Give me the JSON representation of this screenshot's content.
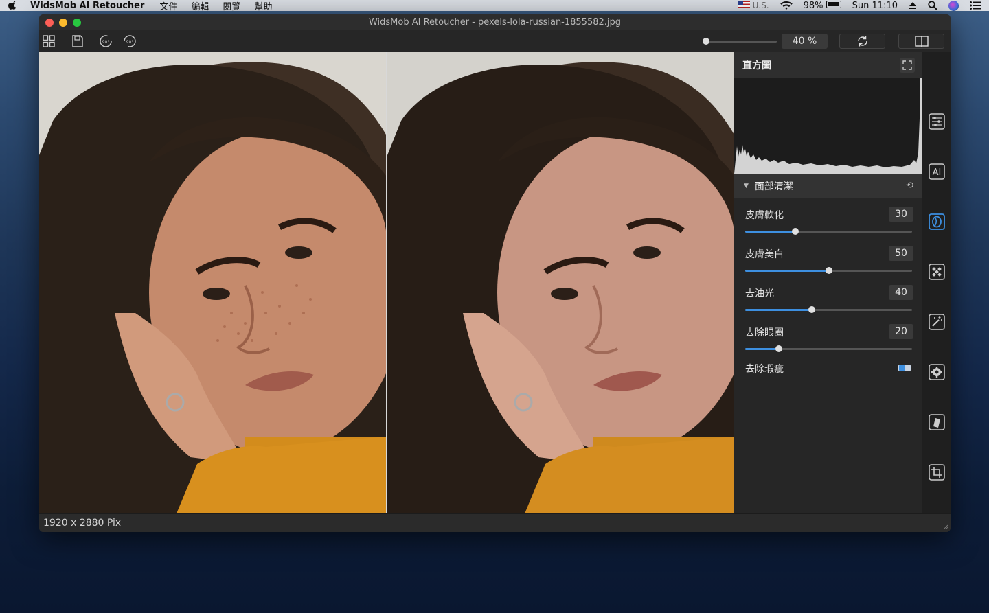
{
  "menubar": {
    "app_name": "WidsMob AI Retoucher",
    "menus": [
      "文件",
      "編輯",
      "閱覽",
      "幫助"
    ],
    "input_source": "U.S.",
    "battery": "98%",
    "clock": "Sun 11:10"
  },
  "window": {
    "title": "WidsMob AI Retoucher - pexels-lola-russian-1855582.jpg"
  },
  "toolbar": {
    "zoom_value": "40 %",
    "zoom_level": 0.04,
    "rotate_left_label": "90°",
    "rotate_right_label": "90°"
  },
  "panel": {
    "histogram_title": "直方圖",
    "section_title": "面部清潔",
    "sliders": [
      {
        "label": "皮膚軟化",
        "value": "30",
        "fraction": 0.3
      },
      {
        "label": "皮膚美白",
        "value": "50",
        "fraction": 0.5
      },
      {
        "label": "去油光",
        "value": "40",
        "fraction": 0.4
      },
      {
        "label": "去除眼圈",
        "value": "20",
        "fraction": 0.2
      }
    ],
    "toggle": {
      "label": "去除瑕疵",
      "on": true
    }
  },
  "status": {
    "dimensions": "1920 x 2880 Pix"
  },
  "rail_icons": [
    "adjust-icon",
    "ai-icon",
    "face-icon",
    "pattern-icon",
    "magic-wand-icon",
    "gear-icon",
    "layers-icon",
    "crop-icon"
  ],
  "colors": {
    "accent": "#3d8fe0",
    "panel_bg": "#262626",
    "desktop": "#14284a"
  }
}
